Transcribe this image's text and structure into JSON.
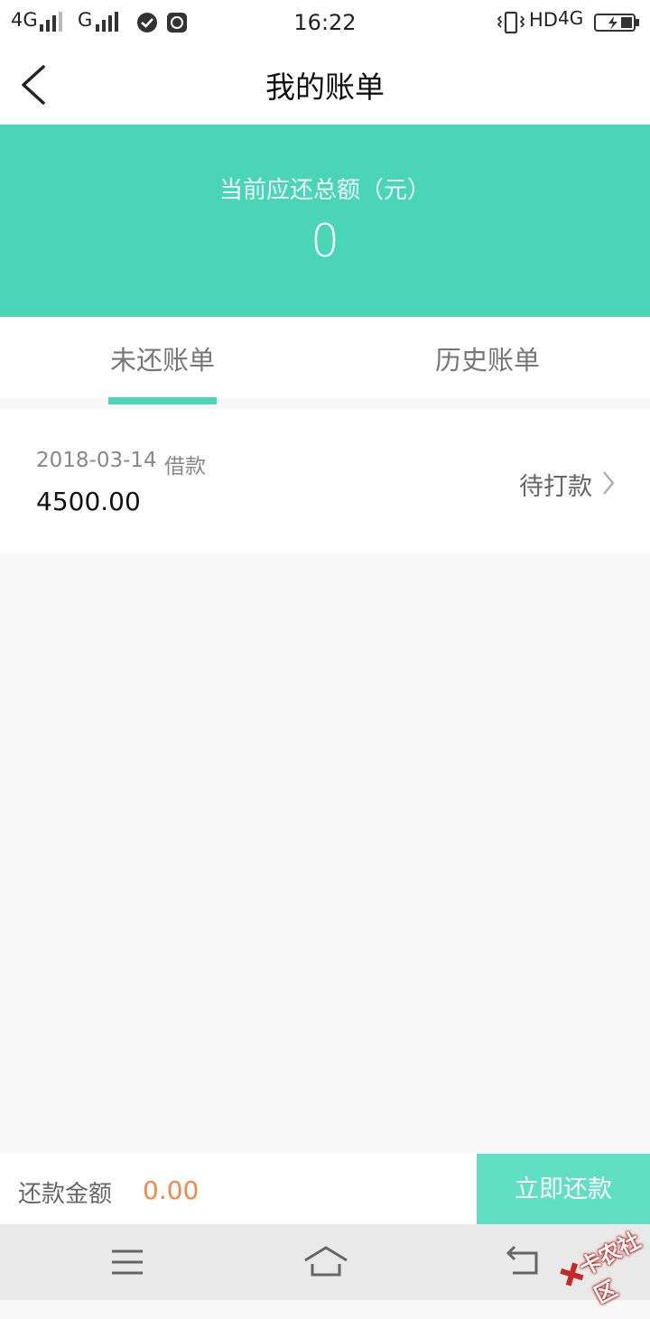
{
  "status_bar": {
    "network1": "4G",
    "network2": "G",
    "time": "16:22",
    "hd": "HD",
    "network3": "4G"
  },
  "header": {
    "title": "我的账单"
  },
  "summary": {
    "label": "当前应还总额（元）",
    "value": "0"
  },
  "tabs": [
    {
      "label": "未还账单",
      "active": true
    },
    {
      "label": "历史账单",
      "active": false
    }
  ],
  "bills": [
    {
      "date": "2018-03-14",
      "type": "借款",
      "amount": "4500.00",
      "status": "待打款"
    }
  ],
  "footer": {
    "label": "还款金额",
    "amount": "0.00",
    "button": "立即还款"
  },
  "watermark": {
    "text": "卡农社区"
  },
  "colors": {
    "accent": "#4ad6b6",
    "button": "#61dfc2",
    "amount": "#f08a4b"
  },
  "icons": [
    "back-arrow-icon",
    "chevron-right-icon",
    "menu-icon",
    "home-icon",
    "return-icon"
  ]
}
